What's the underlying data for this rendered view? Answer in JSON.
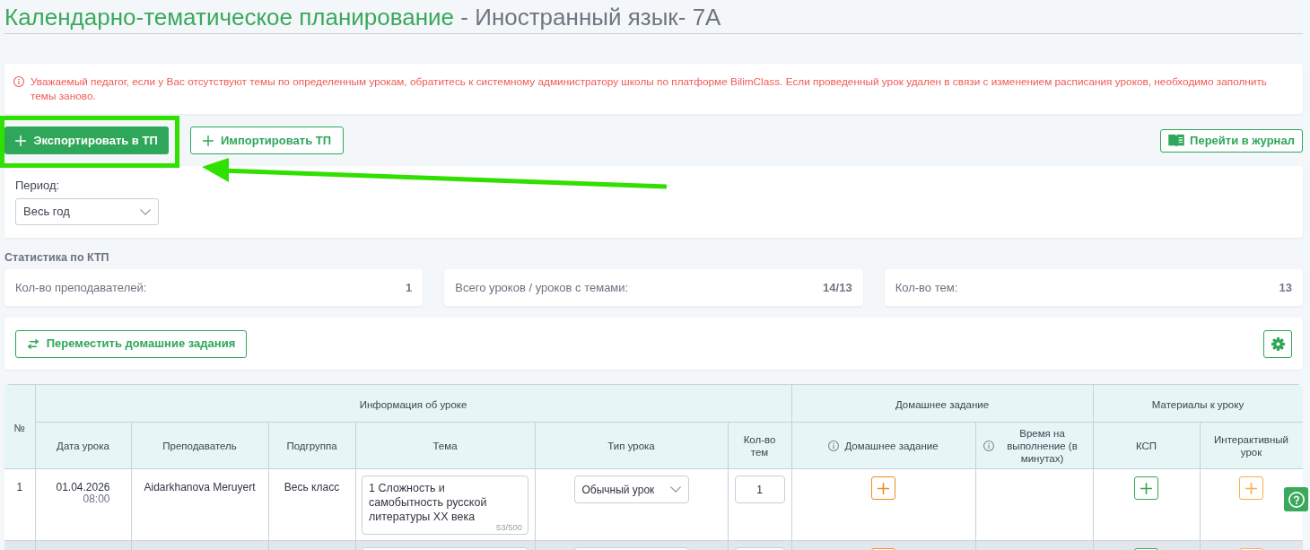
{
  "page_title": {
    "main": "Календарно-тематическое планирование",
    "suffix": " - Иностранный язык- 7А"
  },
  "alert": {
    "text": "Уважаемый педагог, если у Вас отсутствуют темы по определенным урокам, обратитесь к системному администратору школы по платформе BilimClass. Если проведенный урок удален в связи с изменением расписания уроков, необходимо заполнить темы заново."
  },
  "actions": [
    {
      "label": "Экспортировать в ТП",
      "kind": "primary",
      "highlighted": true
    },
    {
      "label": "Импортировать ТП",
      "kind": "outline",
      "highlighted": false
    }
  ],
  "journal_button": {
    "label": "Перейти в журнал"
  },
  "period": {
    "label": "Период:",
    "value": "Весь год"
  },
  "statistics": {
    "title": "Статистика по КТП",
    "cards": [
      {
        "label": "Кол-во преподавателей:",
        "value": "1"
      },
      {
        "label": "Всего уроков / уроков с темами:",
        "value": "14/13"
      },
      {
        "label": "Кол-во тем:",
        "value": "13"
      }
    ]
  },
  "homework_toolbar": {
    "move_button": "Переместить домашние задания"
  },
  "table": {
    "number_header": "№",
    "groups": [
      {
        "label": "Информация об уроке",
        "columns": [
          {
            "label": "Дата урока",
            "kind": "date",
            "info": false
          },
          {
            "label": "Преподаватель",
            "kind": "teacher",
            "info": false
          },
          {
            "label": "Подгруппа",
            "kind": "subgroup",
            "info": false
          },
          {
            "label": "Тема",
            "kind": "topic",
            "info": false
          },
          {
            "label": "Тип урока",
            "kind": "lesson-type",
            "info": false
          },
          {
            "label": "Кол-во тем",
            "kind": "topic-count",
            "info": false
          }
        ]
      },
      {
        "label": "Домашнее задание",
        "columns": [
          {
            "label": "Домашнее задание",
            "kind": "add",
            "info": true,
            "color": "#f08a24"
          },
          {
            "label": "Время на выполнение (в минутах)",
            "kind": "blank",
            "info": true
          }
        ]
      },
      {
        "label": "Материалы к уроку",
        "columns": [
          {
            "label": "КСП",
            "kind": "add",
            "info": false,
            "color": "#34a853"
          },
          {
            "label": "Интерактивный урок",
            "kind": "add",
            "info": false,
            "color": "#f5b04c"
          }
        ]
      }
    ],
    "rows": [
      {
        "number": "1",
        "date": "01.04.2026",
        "time": "08:00",
        "teacher": "Aidarkhanova Meruyert",
        "subgroup": "Весь класс",
        "topic": "1 Сложность и самобытность русской литературы XX века",
        "topic_counter": "53/500",
        "lesson_type": "Обычный урок",
        "topic_count": "1",
        "shaded": false
      },
      {
        "shaded": true
      }
    ]
  }
}
